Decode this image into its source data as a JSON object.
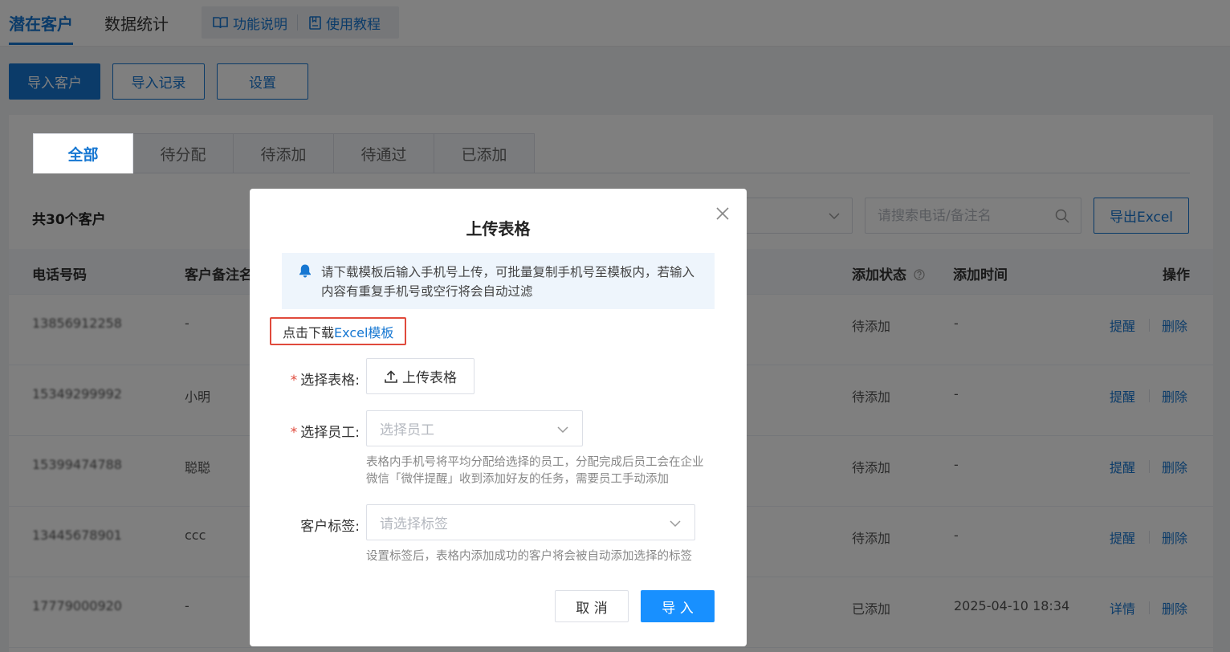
{
  "header": {
    "tabs": [
      {
        "label": "潜在客户",
        "active": true
      },
      {
        "label": "数据统计",
        "active": false
      }
    ],
    "help_links": [
      {
        "label": "功能说明",
        "icon": "book-icon"
      },
      {
        "label": "使用教程",
        "icon": "document-icon"
      }
    ]
  },
  "actions": {
    "import_customer": "导入客户",
    "import_records": "导入记录",
    "settings": "设置"
  },
  "status_tabs": [
    {
      "label": "全部",
      "active": true
    },
    {
      "label": "待分配",
      "active": false
    },
    {
      "label": "待添加",
      "active": false
    },
    {
      "label": "待通过",
      "active": false
    },
    {
      "label": "已添加",
      "active": false
    }
  ],
  "list": {
    "count_label": "共30个客户",
    "search_placeholder": "请搜索电话/备注名",
    "export_label": "导出Excel"
  },
  "table": {
    "columns": {
      "phone": "电话号码",
      "remark": "客户备注名",
      "status": "添加状态",
      "time": "添加时间",
      "ops": "操作"
    },
    "rows": [
      {
        "phone": "13856912258",
        "remark": "-",
        "status": "待添加",
        "time": "-",
        "op1": "提醒",
        "op2": "删除"
      },
      {
        "phone": "15349299992",
        "remark": "小明",
        "status": "待添加",
        "time": "-",
        "op1": "提醒",
        "op2": "删除"
      },
      {
        "phone": "15399474788",
        "remark": "聪聪",
        "status": "待添加",
        "time": "-",
        "op1": "提醒",
        "op2": "删除"
      },
      {
        "phone": "13445678901",
        "remark": "ccc",
        "status": "待添加",
        "time": "-",
        "op1": "提醒",
        "op2": "删除"
      },
      {
        "phone": "17779000920",
        "remark": "-",
        "status": "已添加",
        "time": "2025-04-10 18:34",
        "op1": "详情",
        "op2": "删除"
      }
    ]
  },
  "dialog": {
    "title": "上传表格",
    "notice": "请下载模板后输入手机号上传，可批量复制手机号至模板内，若输入内容有重复手机号或空行将会自动过滤",
    "download_prefix": "点击下载",
    "download_link": "Excel模板",
    "required_mark": "*",
    "fields": {
      "file_label": "选择表格:",
      "upload_button": "上传表格",
      "staff_label": "选择员工:",
      "staff_placeholder": "选择员工",
      "staff_hint": "表格内手机号将平均分配给选择的员工，分配完成后员工会在企业微信「微伴提醒」收到添加好友的任务，需要员工手动添加",
      "tag_label": "客户标签:",
      "tag_placeholder": "请选择标签",
      "tag_hint": "设置标签后，表格内添加成功的客户将会被自动添加选择的标签"
    },
    "cancel": "取 消",
    "confirm": "导 入"
  },
  "colors": {
    "primary": "#1677d2",
    "confirm": "#1890ff",
    "highlight_border": "#e04a3c"
  }
}
